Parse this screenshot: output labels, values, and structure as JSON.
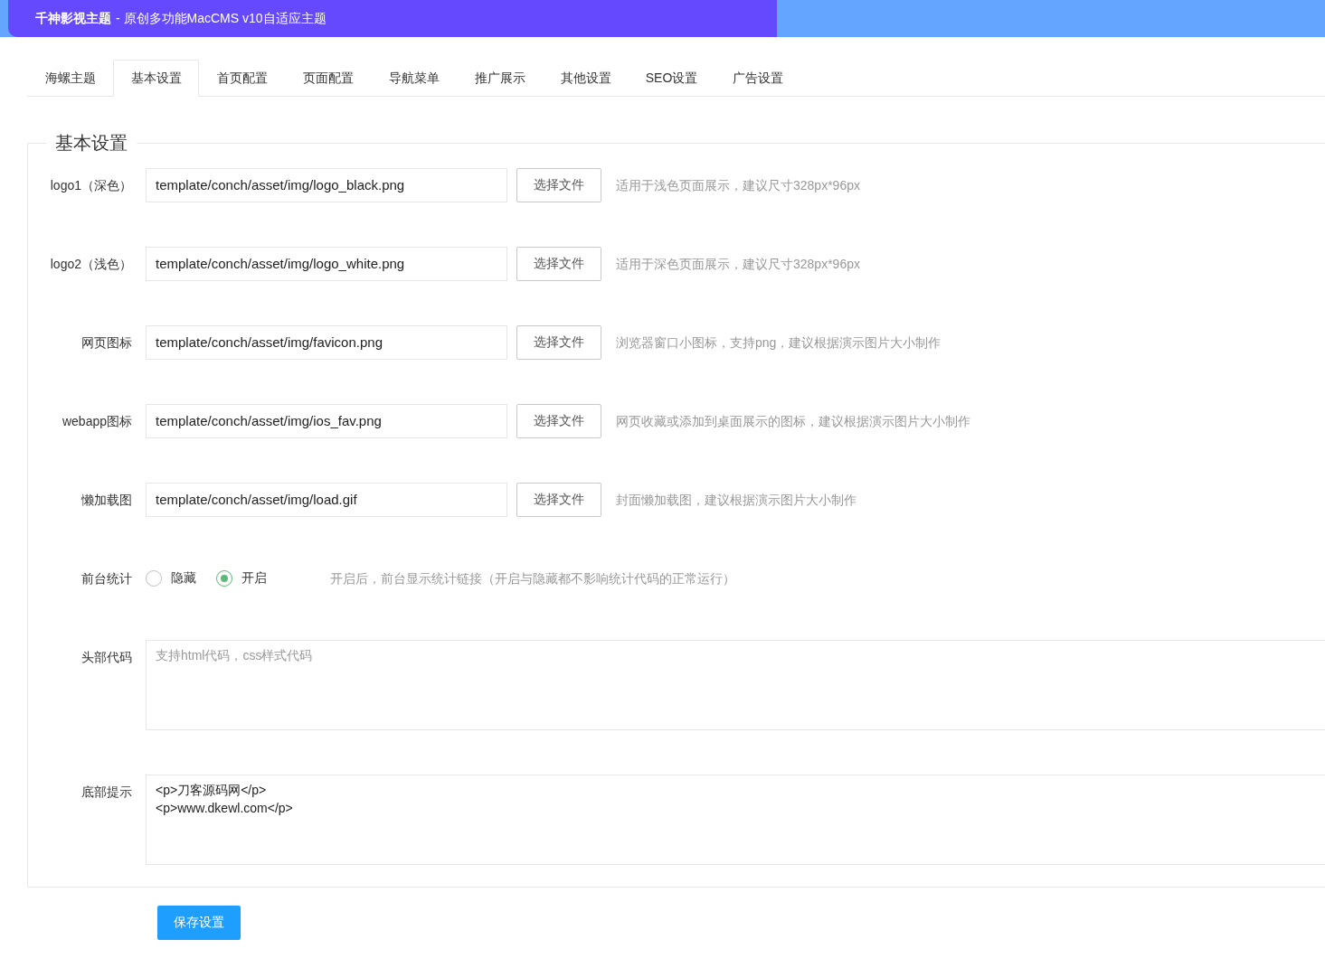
{
  "header": {
    "title": "千神影视主题",
    "subtitle": "- 原创多功能MacCMS v10自适应主题"
  },
  "tabs": [
    {
      "label": "海螺主题",
      "selected": false
    },
    {
      "label": "基本设置",
      "selected": true
    },
    {
      "label": "首页配置",
      "selected": false
    },
    {
      "label": "页面配置",
      "selected": false
    },
    {
      "label": "导航菜单",
      "selected": false
    },
    {
      "label": "推广展示",
      "selected": false
    },
    {
      "label": "其他设置",
      "selected": false
    },
    {
      "label": "SEO设置",
      "selected": false
    },
    {
      "label": "广告设置",
      "selected": false
    }
  ],
  "section": {
    "legend": "基本设置",
    "fields": [
      {
        "kind": "file",
        "label": "logo1（深色）",
        "value": "template/conch/asset/img/logo_black.png",
        "button": "选择文件",
        "hint": "适用于浅色页面展示，建议尺寸328px*96px"
      },
      {
        "kind": "file",
        "label": "logo2（浅色）",
        "value": "template/conch/asset/img/logo_white.png",
        "button": "选择文件",
        "hint": "适用于深色页面展示，建议尺寸328px*96px"
      },
      {
        "kind": "file",
        "label": "网页图标",
        "value": "template/conch/asset/img/favicon.png",
        "button": "选择文件",
        "hint": "浏览器窗口小图标，支持png，建议根据演示图片大小制作"
      },
      {
        "kind": "file",
        "label": "webapp图标",
        "value": "template/conch/asset/img/ios_fav.png",
        "button": "选择文件",
        "hint": "网页收藏或添加到桌面展示的图标，建议根据演示图片大小制作"
      },
      {
        "kind": "file",
        "label": "懒加载图",
        "value": "template/conch/asset/img/load.gif",
        "button": "选择文件",
        "hint": "封面懒加载图，建议根据演示图片大小制作"
      },
      {
        "kind": "radio",
        "label": "前台统计",
        "options": [
          {
            "label": "隐藏",
            "selected": false
          },
          {
            "label": "开启",
            "selected": true
          }
        ],
        "hint": "开启后，前台显示统计链接（开启与隐藏都不影响统计代码的正常运行）"
      },
      {
        "kind": "textarea",
        "label": "头部代码",
        "placeholder": "支持html代码，css样式代码"
      },
      {
        "kind": "textarea",
        "label": "底部提示",
        "lines": [
          "<p>刀客源码网</p>",
          "<p>www.dkewl.com</p>"
        ]
      }
    ]
  },
  "save_button": "保存设置"
}
